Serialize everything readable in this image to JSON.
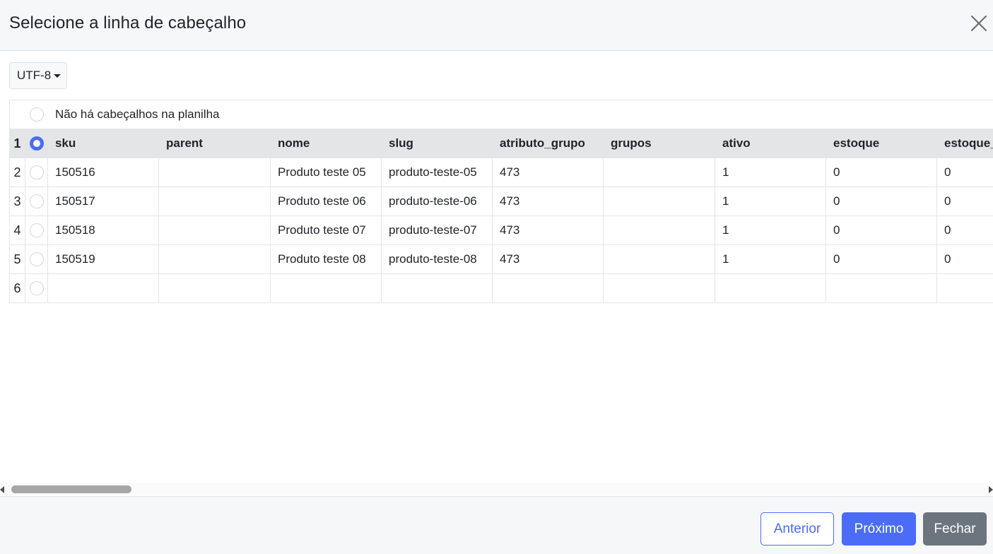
{
  "dialog": {
    "title": "Selecione a linha de cabeçalho"
  },
  "encoding": {
    "selected": "UTF-8"
  },
  "table": {
    "no_header_label": "Não há cabeçalhos na planilha",
    "selected_row": 1,
    "rows": [
      {
        "num": "1",
        "cells": [
          "sku",
          "parent",
          "nome",
          "slug",
          "atributo_grupo",
          "grupos",
          "ativo",
          "estoque",
          "estoque_"
        ]
      },
      {
        "num": "2",
        "cells": [
          "150516",
          "",
          "Produto teste 05",
          "produto-teste-05",
          "473",
          "",
          "1",
          "0",
          "0"
        ]
      },
      {
        "num": "3",
        "cells": [
          "150517",
          "",
          "Produto teste 06",
          "produto-teste-06",
          "473",
          "",
          "1",
          "0",
          "0"
        ]
      },
      {
        "num": "4",
        "cells": [
          "150518",
          "",
          "Produto teste 07",
          "produto-teste-07",
          "473",
          "",
          "1",
          "0",
          "0"
        ]
      },
      {
        "num": "5",
        "cells": [
          "150519",
          "",
          "Produto teste 08",
          "produto-teste-08",
          "473",
          "",
          "1",
          "0",
          "0"
        ]
      },
      {
        "num": "6",
        "cells": [
          "",
          "",
          "",
          "",
          "",
          "",
          "",
          "",
          ""
        ]
      }
    ]
  },
  "footer": {
    "prev_label": "Anterior",
    "next_label": "Próximo",
    "close_label": "Fechar"
  },
  "colors": {
    "accent": "#4a6cf7",
    "secondary": "#6c757d",
    "header_row_bg": "#e4e5e7"
  },
  "icons": {
    "close": "close-icon",
    "caret": "caret-down-icon"
  }
}
